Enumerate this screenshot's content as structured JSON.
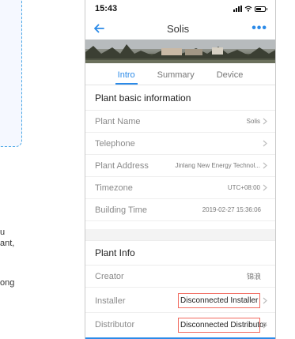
{
  "left": {
    "line1": "u",
    "line2": "ant,",
    "line3": "ong"
  },
  "status": {
    "time": "15:43"
  },
  "nav": {
    "title": "Solis",
    "more": "•••"
  },
  "tabs": [
    {
      "label": "Intro",
      "active": true
    },
    {
      "label": "Summary",
      "active": false
    },
    {
      "label": "Device",
      "active": false
    }
  ],
  "basic": {
    "title": "Plant basic information",
    "rows": [
      {
        "label": "Plant Name",
        "value": "Solis",
        "chevron": true
      },
      {
        "label": "Telephone",
        "value": "",
        "chevron": true
      },
      {
        "label": "Plant Address",
        "value": "Jinlang New Energy Technol...",
        "chevron": true
      },
      {
        "label": "Timezone",
        "value": "UTC+08:00",
        "chevron": true
      },
      {
        "label": "Building Time",
        "value": "2019-02-27 15:36:06",
        "chevron": false
      }
    ]
  },
  "info": {
    "title": "Plant Info",
    "rows": [
      {
        "label": "Creator",
        "value": "锦浪",
        "chevron": false
      },
      {
        "label": "Installer",
        "value": "Disconnected Installer",
        "chevron": true,
        "highlight": true
      },
      {
        "label": "Distributor",
        "value": "Disconnected Distributor",
        "chevron": true,
        "highlight": true
      }
    ]
  },
  "colors": {
    "accent": "#2b8ae8",
    "highlight_border": "#f16a5f"
  }
}
